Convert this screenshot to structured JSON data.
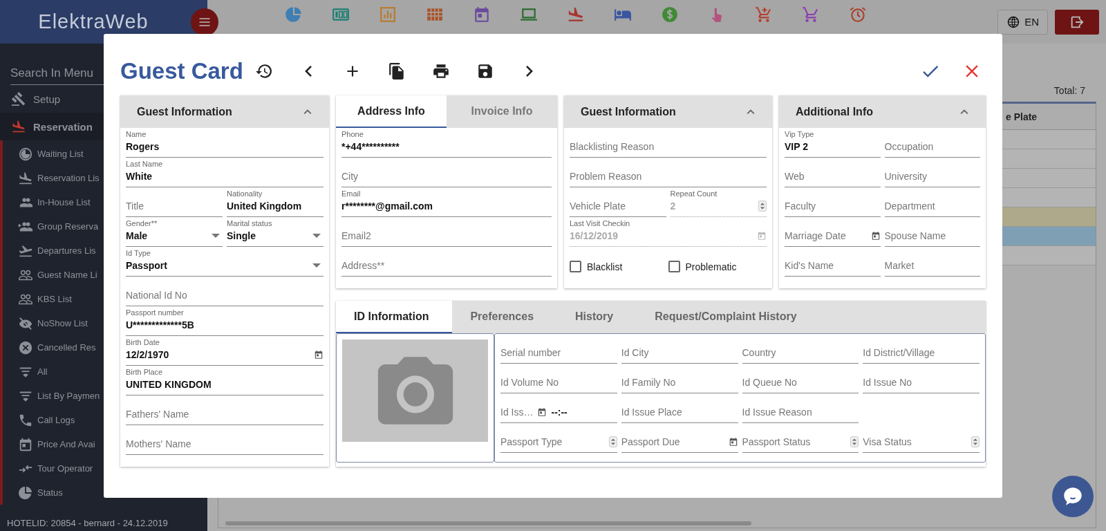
{
  "app": {
    "logo": "ElektraWeb",
    "language": "EN",
    "toolbar": [
      {
        "kind": "pie",
        "color": "#3f7fb3"
      },
      {
        "kind": "counter",
        "color": "#1f7f73"
      },
      {
        "kind": "bars",
        "color": "#b97a2c"
      },
      {
        "kind": "grid",
        "color": "#a9532a"
      },
      {
        "kind": "calendar",
        "color": "#6a4a9c"
      },
      {
        "kind": "laptop",
        "color": "#2a6a2e"
      },
      {
        "kind": "plane",
        "color": "#a8332e"
      },
      {
        "kind": "bed",
        "color": "#3a55a0"
      },
      {
        "kind": "coin",
        "color": "#3f8a35"
      },
      {
        "kind": "hand",
        "color": "#b5527f"
      },
      {
        "kind": "cart-plus",
        "color": "#b5402f"
      },
      {
        "kind": "cart",
        "color": "#8a3fb0"
      },
      {
        "kind": "alarm",
        "color": "#a8402b"
      }
    ]
  },
  "sidebar": {
    "search_placeholder": "Search In Menu",
    "items": [
      {
        "label": "Setup",
        "kind": "gavel",
        "expanded": false
      },
      {
        "label": "Reservation",
        "kind": "plane",
        "expanded": true,
        "children": [
          {
            "label": "Waiting List",
            "kind": "clock"
          },
          {
            "label": "Reservation Lis",
            "kind": "plane"
          },
          {
            "label": "In-House List",
            "kind": "people"
          },
          {
            "label": "Group Reserva",
            "kind": "people-add"
          },
          {
            "label": "Departures Lis",
            "kind": "takeoff"
          },
          {
            "label": "Guest Name Li",
            "kind": "people-outline"
          },
          {
            "label": "KBS List",
            "kind": "people-outline"
          },
          {
            "label": "NoShow List",
            "kind": "eye-off"
          },
          {
            "label": "Cancelled Res",
            "kind": "cancel"
          },
          {
            "label": "All",
            "kind": "sort"
          },
          {
            "label": "List By Paymen",
            "kind": "sort"
          },
          {
            "label": "Call Logs",
            "kind": "phone"
          },
          {
            "label": "Price And Avai",
            "kind": "event"
          },
          {
            "label": "Tour Operator",
            "kind": "swap"
          },
          {
            "label": "Status",
            "kind": "pie"
          }
        ]
      }
    ],
    "footer": "HOTELID: 20854 - bernard - 24.12.2019"
  },
  "list": {
    "total": "Total: 7",
    "column": "e Plate",
    "rows": [
      {
        "color": "#b4b4b4"
      },
      {
        "color": "#b4b4b4"
      },
      {
        "color": "#b4b4b4"
      },
      {
        "color": "#b4b4b4"
      },
      {
        "color": "#aea98a"
      },
      {
        "color": "#7f9fb5"
      },
      {
        "color": "#b4b4b4"
      }
    ]
  },
  "dialog": {
    "title": "Guest Card",
    "actions": [
      {
        "kind": "history"
      },
      {
        "kind": "previous"
      },
      {
        "kind": "add"
      },
      {
        "kind": "copy"
      },
      {
        "kind": "print"
      },
      {
        "kind": "save"
      },
      {
        "kind": "next"
      }
    ],
    "guest_information": {
      "title": "Guest Information",
      "expanded": true,
      "rows": [
        [
          {
            "kind": "text",
            "label": "Name",
            "value": "Rogers"
          }
        ],
        [
          {
            "kind": "text",
            "label": "Last Name",
            "value": "White"
          }
        ],
        [
          {
            "kind": "text",
            "placeholder": "Title"
          },
          {
            "kind": "text",
            "label": "Nationality",
            "value": "United Kingdom"
          }
        ],
        [
          {
            "kind": "select",
            "label": "Gender**",
            "value": "Male"
          },
          {
            "kind": "select",
            "label": "Marital status",
            "value": "Single"
          }
        ],
        [
          {
            "kind": "select",
            "label": "Id Type",
            "value": "Passport"
          }
        ],
        [
          {
            "kind": "text",
            "placeholder": "National Id No"
          }
        ],
        [
          {
            "kind": "text",
            "label": "Passport number",
            "value": "U*************5B"
          }
        ],
        [
          {
            "kind": "date",
            "label": "Birth Date",
            "value": "12/2/1970"
          }
        ],
        [
          {
            "kind": "text",
            "label": "Birth Place",
            "value": "UNITED KINGDOM"
          }
        ],
        [
          {
            "kind": "text",
            "placeholder": "Fathers' Name"
          }
        ],
        [
          {
            "kind": "text",
            "placeholder": "Mothers' Name"
          }
        ]
      ]
    },
    "contact": {
      "tabs": [
        {
          "label": "Address Info",
          "selected": true
        },
        {
          "label": "Invoice Info",
          "selected": false
        }
      ],
      "rows": [
        [
          {
            "kind": "text",
            "label": "Phone",
            "value": "*+44**********"
          }
        ],
        [
          {
            "kind": "text",
            "placeholder": "City"
          }
        ],
        [
          {
            "kind": "text",
            "label": "Email",
            "value": "r********@gmail.com"
          }
        ],
        [
          {
            "kind": "text",
            "placeholder": "Email2"
          }
        ],
        [
          {
            "kind": "text",
            "placeholder": "Address**"
          }
        ]
      ]
    },
    "guest_status": {
      "title": "Guest Information",
      "expanded": true,
      "rows": [
        [
          {
            "kind": "text",
            "placeholder": "Blacklisting Reason",
            "disabled": false
          }
        ],
        [
          {
            "kind": "text",
            "placeholder": "Problem Reason",
            "disabled": false
          }
        ],
        [
          {
            "kind": "text",
            "placeholder": "Vehicle Plate",
            "disabled": false
          },
          {
            "kind": "spin",
            "label": "Repeat Count",
            "value": "2",
            "disabled": true
          }
        ],
        [
          {
            "kind": "date",
            "label": "Last Visit Checkin",
            "value": "16/12/2019",
            "disabled": true
          }
        ]
      ],
      "checkboxes": [
        {
          "label": "Blacklist",
          "checked": false
        },
        {
          "label": "Problematic",
          "checked": false
        }
      ]
    },
    "additional_info": {
      "title": "Additional Info",
      "expanded": true,
      "rows": [
        [
          {
            "kind": "text",
            "label": "Vip Type",
            "value": "VIP 2"
          },
          {
            "kind": "text",
            "placeholder": "Occupation"
          }
        ],
        [
          {
            "kind": "text",
            "placeholder": "Web"
          },
          {
            "kind": "text",
            "placeholder": "University"
          }
        ],
        [
          {
            "kind": "text",
            "placeholder": "Faculty"
          },
          {
            "kind": "text",
            "placeholder": "Department"
          }
        ],
        [
          {
            "kind": "date",
            "placeholder": "Marriage Date"
          },
          {
            "kind": "text",
            "placeholder": "Spouse Name"
          }
        ],
        [
          {
            "kind": "text",
            "placeholder": "Kid's Name"
          },
          {
            "kind": "text",
            "placeholder": "Market"
          }
        ]
      ]
    },
    "id_section": {
      "tabs": [
        {
          "label": "ID Information",
          "selected": true
        },
        {
          "label": "Preferences",
          "selected": false
        },
        {
          "label": "History",
          "selected": false
        },
        {
          "label": "Request/Complaint History",
          "selected": false
        }
      ],
      "rows": [
        [
          {
            "kind": "text",
            "placeholder": "Serial number"
          },
          {
            "kind": "text",
            "placeholder": "Id City"
          },
          {
            "kind": "text",
            "placeholder": "Country"
          },
          {
            "kind": "text",
            "placeholder": "Id District/Village"
          }
        ],
        [
          {
            "kind": "text",
            "placeholder": "Id Volume No"
          },
          {
            "kind": "text",
            "placeholder": "Id Family No"
          },
          {
            "kind": "text",
            "placeholder": "Id Queue No"
          },
          {
            "kind": "text",
            "placeholder": "Id Issue No"
          }
        ],
        [
          {
            "kind": "datetime",
            "placeholder": "Id Iss…",
            "value": "--:--"
          },
          {
            "kind": "text",
            "placeholder": "Id Issue Place"
          },
          {
            "kind": "text",
            "placeholder": "Id Issue Reason"
          }
        ],
        [
          {
            "kind": "spin",
            "placeholder": "Passport Type"
          },
          {
            "kind": "date",
            "placeholder": "Passport Due"
          },
          {
            "kind": "spin",
            "placeholder": "Passport Status"
          },
          {
            "kind": "spin",
            "placeholder": "Visa Status"
          }
        ]
      ]
    }
  }
}
